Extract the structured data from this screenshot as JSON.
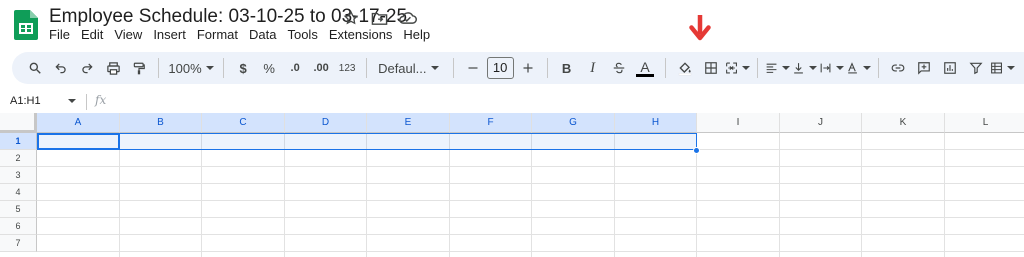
{
  "app": {
    "title": "Employee Schedule: 03-10-25 to 03-17-25",
    "icons": [
      "star-icon",
      "move-to-folder-icon",
      "cloud-status-icon"
    ]
  },
  "menu": [
    "File",
    "Edit",
    "View",
    "Insert",
    "Format",
    "Data",
    "Tools",
    "Extensions",
    "Help"
  ],
  "toolbar": {
    "zoom": "100%",
    "currency": "$",
    "percent": "%",
    "decrease_decimal": ".0",
    "increase_decimal": ".00",
    "number_format": "123",
    "font": "Defaul...",
    "font_size": "10",
    "bold": "B",
    "italic": "I",
    "text_color_letter": "A",
    "text_color": "#000000",
    "accent_red": "#e53935"
  },
  "formula_bar": {
    "name_box": "A1:H1",
    "fx": "fx"
  },
  "columns": [
    "A",
    "B",
    "C",
    "D",
    "E",
    "F",
    "G",
    "H",
    "I",
    "J",
    "K",
    "L"
  ],
  "rows": [
    "1",
    "2",
    "3",
    "4",
    "5",
    "6",
    "7"
  ],
  "selection": {
    "range": "A1:H1",
    "active_cell": "A1"
  },
  "colors": {
    "selection": "#1a73e8",
    "header_selected_bg": "#d3e3fd",
    "toolbar_bg": "#edf2fa"
  }
}
